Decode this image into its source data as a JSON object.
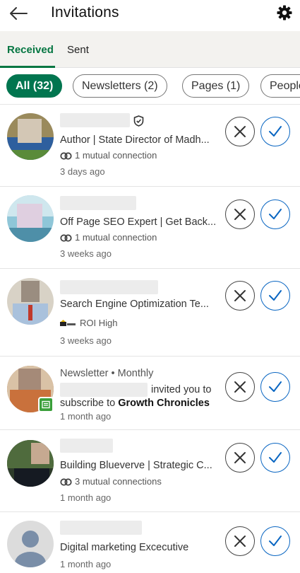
{
  "header": {
    "title": "Invitations",
    "back_icon": "arrow-left-icon",
    "settings_icon": "gear-icon"
  },
  "tabs": [
    {
      "label": "Received",
      "active": true
    },
    {
      "label": "Sent",
      "active": false
    }
  ],
  "filters": [
    {
      "label": "All (32)",
      "selected": true
    },
    {
      "label": "Newsletters (2)",
      "selected": false
    },
    {
      "label": "Pages (1)",
      "selected": false
    },
    {
      "label": "People",
      "selected": false
    }
  ],
  "colors": {
    "accent_green": "#01754f",
    "accept_blue": "#0a66c2"
  },
  "invitations": [
    {
      "name": "",
      "verified": true,
      "headline": "Author | State Director of Madh...",
      "meta": "1 mutual connection",
      "meta_icon": "mutual-connection-icon",
      "time": "3 days ago"
    },
    {
      "name": "",
      "headline": "Off Page SEO Expert | Get Back...",
      "meta": "1 mutual connection",
      "meta_icon": "mutual-connection-icon",
      "time": "3 weeks ago"
    },
    {
      "name": "",
      "headline": "Search Engine Optimization Te...",
      "meta": "ROI High",
      "meta_icon": "company-logo-icon",
      "time": "3 weeks ago"
    },
    {
      "type": "newsletter",
      "header": "Newsletter • Monthly",
      "invite_text": "invited you to",
      "subscribe_text": "subscribe to",
      "newsletter_name": "Growth Chronicles",
      "time": "1 month ago"
    },
    {
      "name": "",
      "headline": "Building Blueverve | Strategic C...",
      "meta": "3 mutual connections",
      "meta_icon": "mutual-connection-icon",
      "time": "1 month ago"
    },
    {
      "name": "",
      "headline": "Digital marketing Excecutive",
      "time": "1 month ago"
    }
  ]
}
